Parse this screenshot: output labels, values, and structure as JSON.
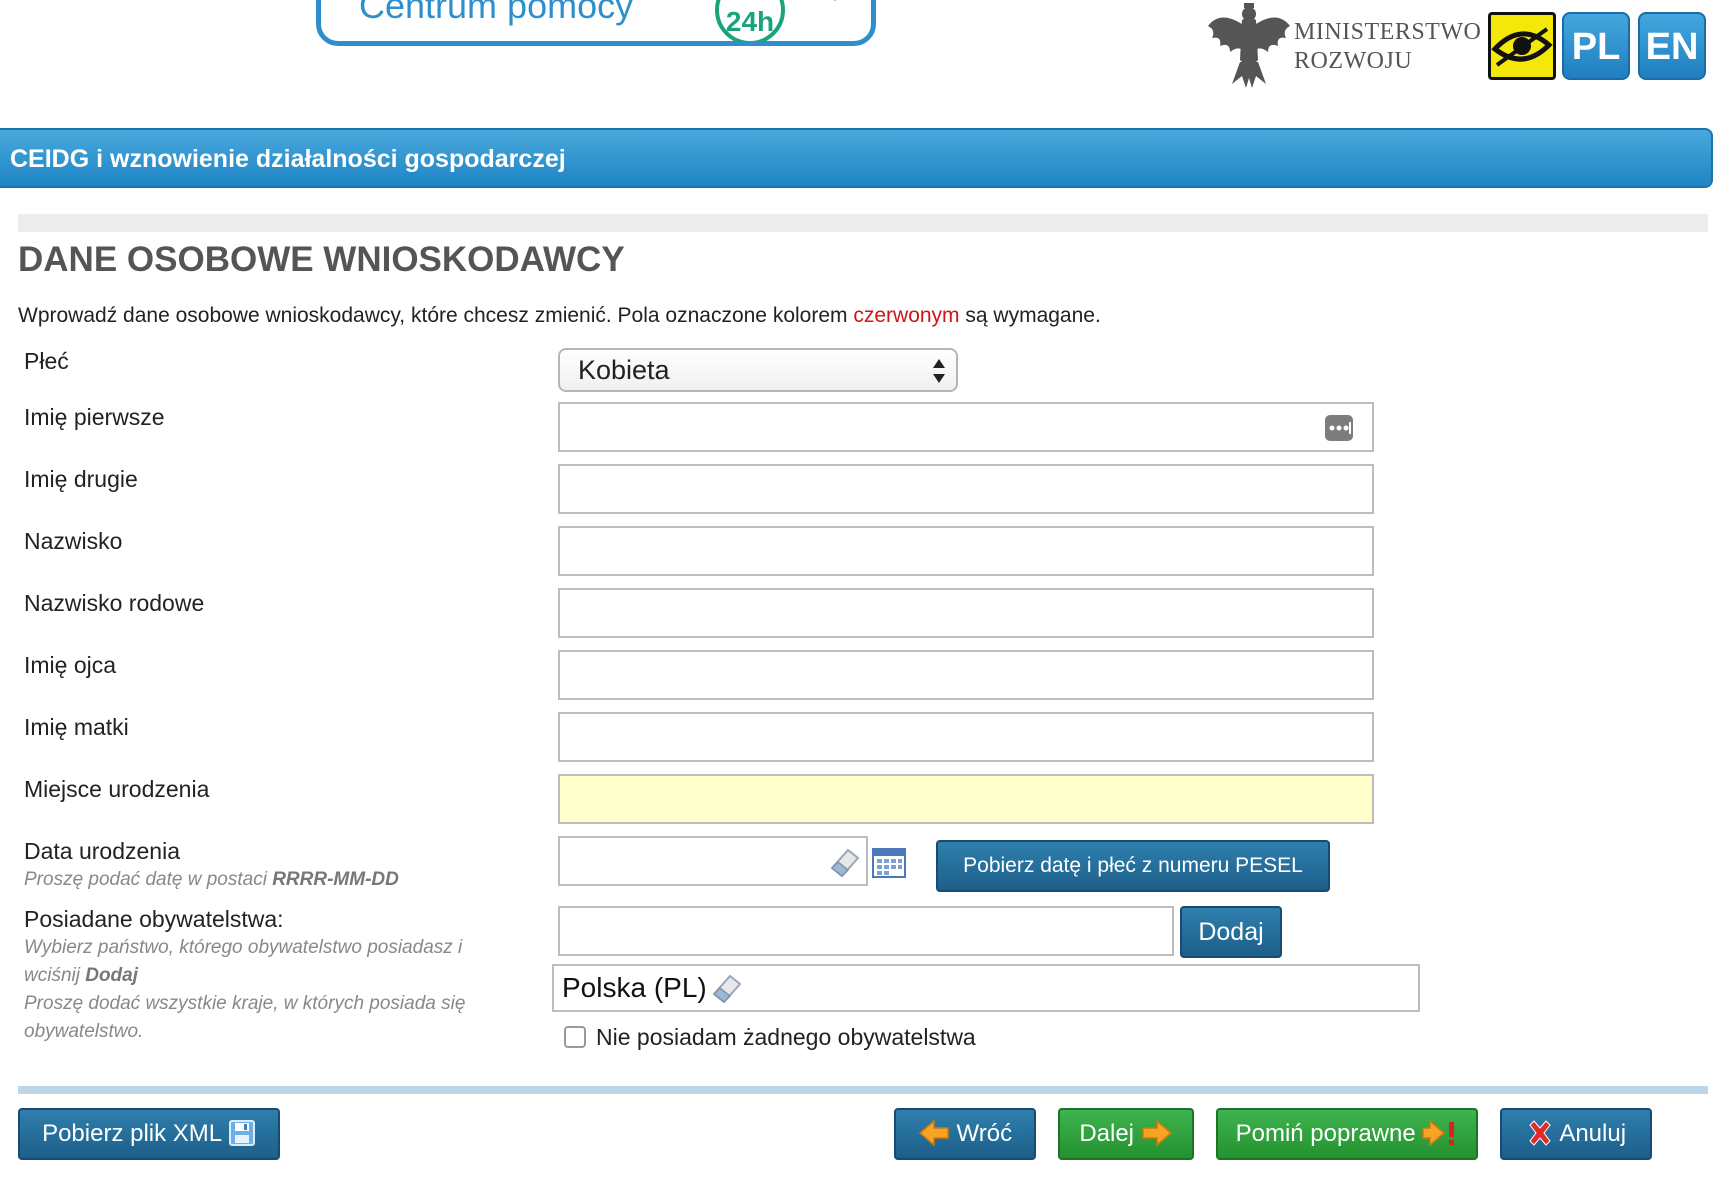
{
  "header": {
    "help_title": "Centrum pomocy",
    "help_badge": "24h",
    "ministry_line1": "MINISTERSTWO",
    "ministry_line2": "ROZWOJU",
    "lang_pl": "PL",
    "lang_en": "EN"
  },
  "title_bar": {
    "text": "CEIDG i wznowienie działalności gospodarczej"
  },
  "page": {
    "title": "DANE OSOBOWE WNIOSKODAWCY",
    "intro_before": "Wprowadź dane osobowe wnioskodawcy, które chcesz zmienić. Pola oznaczone kolorem ",
    "intro_red": "czerwonym",
    "intro_after": " są wymagane."
  },
  "form": {
    "gender_label": "Płeć",
    "gender_value": "Kobieta",
    "first_name_label": "Imię pierwsze",
    "second_name_label": "Imię drugie",
    "surname_label": "Nazwisko",
    "family_name_label": "Nazwisko rodowe",
    "father_name_label": "Imię ojca",
    "mother_name_label": "Imię matki",
    "birthplace_label": "Miejsce urodzenia",
    "birthdate_label": "Data urodzenia",
    "birthdate_hint_prefix": "Proszę podać datę w postaci ",
    "birthdate_hint_format": "RRRR-MM-DD",
    "pesel_button": "Pobierz datę i płeć z numeru PESEL",
    "citizenship_label": "Posiadane obywatelstwa:",
    "citizenship_hint_1": "Wybierz państwo, którego obywatelstwo posiadasz i",
    "citizenship_hint_2_prefix": "wciśnij ",
    "citizenship_hint_2_bold": "Dodaj",
    "citizenship_hint_3": "Proszę dodać wszystkie kraje, w których posiada się",
    "citizenship_hint_4": "obywatelstwo.",
    "add_button": "Dodaj",
    "citizenship_value": "Polska (PL)",
    "no_citizenship_label": "Nie posiadam żadnego obywatelstwa"
  },
  "footer": {
    "xml_button": "Pobierz plik XML",
    "back_button": "Wróć",
    "next_button": "Dalej",
    "skip_button": "Pomiń poprawne",
    "cancel_button": "Anuluj"
  }
}
